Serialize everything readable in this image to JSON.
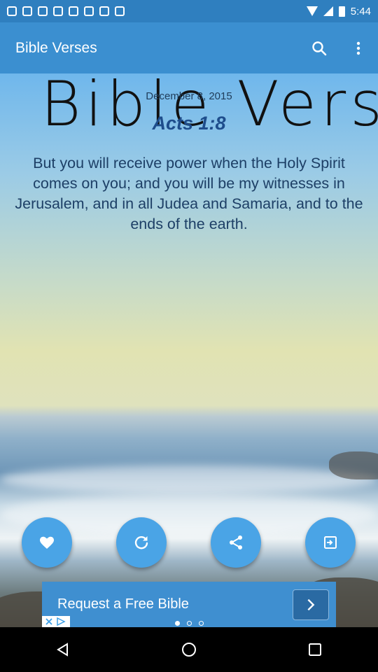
{
  "status_bar": {
    "time": "5:44"
  },
  "app_bar": {
    "title": "Bible Verses",
    "actions": [
      {
        "name": "search",
        "icon": "search-icon"
      },
      {
        "name": "more",
        "icon": "more-vert-icon"
      }
    ]
  },
  "verse": {
    "overlay_title": "Bible Verse",
    "date": "December 8, 2015",
    "reference": "Acts 1:8",
    "text": "But you will receive power when the Holy Spirit comes on you; and you will be my witnesses in Jerusalem, and in all Judea and Samaria, and to the ends of the earth."
  },
  "actions": [
    {
      "name": "favorite",
      "icon": "heart-icon"
    },
    {
      "name": "refresh",
      "icon": "refresh-icon"
    },
    {
      "name": "share",
      "icon": "share-icon"
    },
    {
      "name": "next",
      "icon": "exit-to-app-icon"
    }
  ],
  "ad": {
    "text": "Request a Free Bible",
    "dots_total": 3,
    "dots_active": 1
  },
  "colors": {
    "status_bar": "#2f7fbf",
    "app_bar": "#3b8fd0",
    "fab": "#4aa4e6",
    "verse_text": "#1d3f66",
    "verse_ref": "#1e4d8c"
  }
}
